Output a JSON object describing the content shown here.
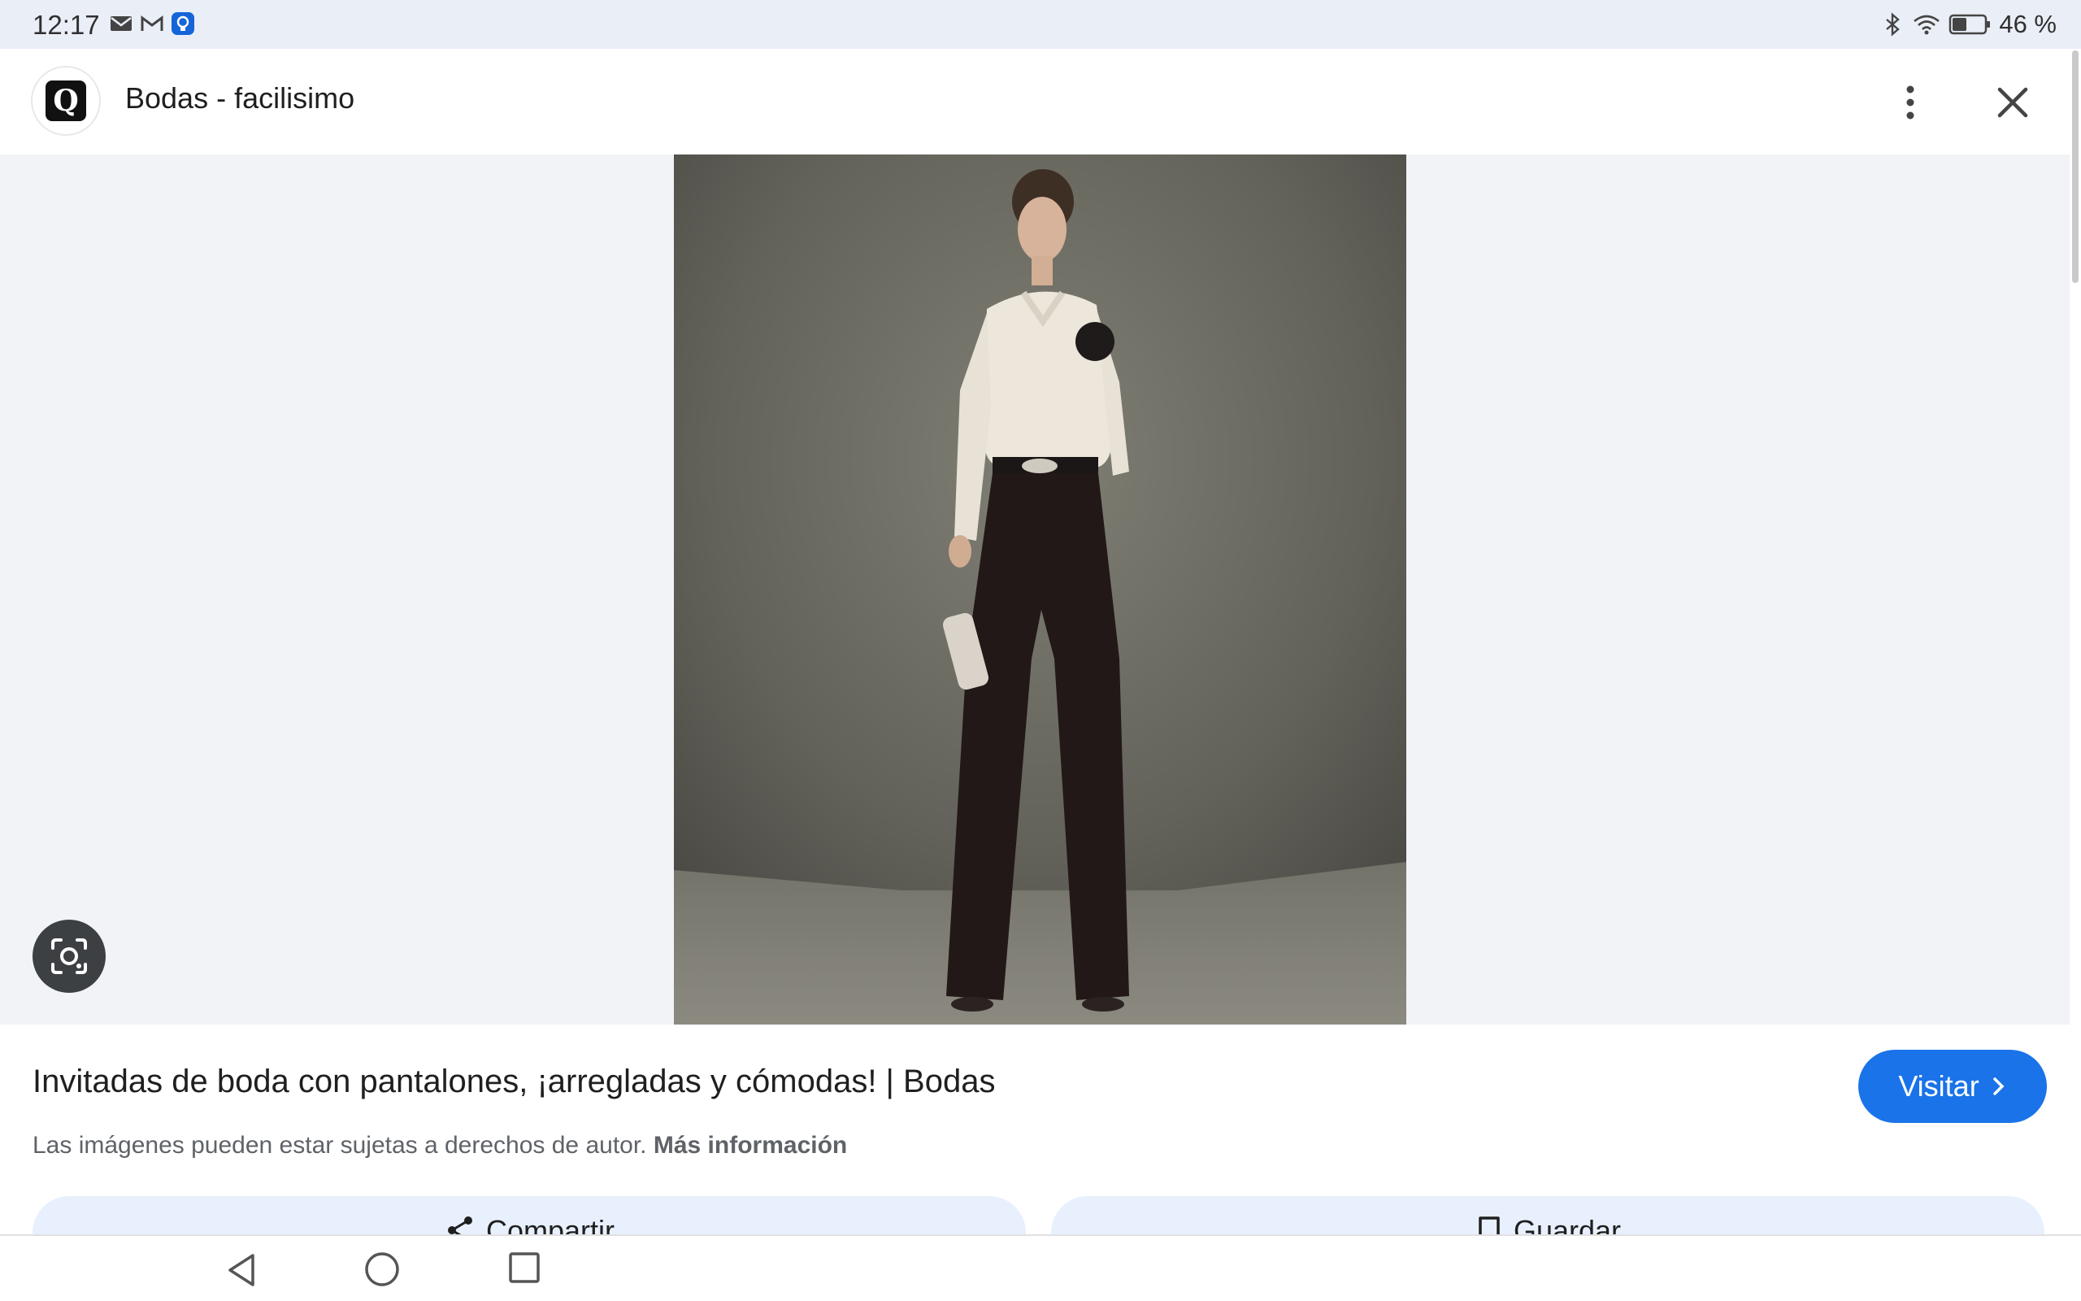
{
  "status_bar": {
    "time": "12:17",
    "notification_icons": [
      "mail-icon",
      "gmail-icon",
      "tips-icon"
    ],
    "system_icons": [
      "bluetooth-icon",
      "wifi-icon",
      "battery-icon"
    ],
    "battery_text": "46 %",
    "battery_level_percent": 46
  },
  "header": {
    "site_title": "Bodas - facilisimo",
    "logo_letter": "Q",
    "more_icon": "more-vert-icon",
    "close_icon": "close-icon"
  },
  "viewer": {
    "lens_icon": "google-lens-icon"
  },
  "result": {
    "title": "Invitadas de boda con pantalones, ¡arregladas y cómodas! | Bodas",
    "copyright_text": "Las imágenes pueden estar sujetas a derechos de autor.",
    "more_info_link": "Más información",
    "visit_label": "Visitar",
    "share_label": "Compartir",
    "save_label": "Guardar"
  },
  "nav_bar": {
    "icons": [
      "back-icon",
      "home-icon",
      "recents-icon"
    ]
  },
  "colors": {
    "accent": "#1a73e8",
    "action_bg": "#e8f0fe",
    "status_bar_bg": "#eaeef7"
  }
}
